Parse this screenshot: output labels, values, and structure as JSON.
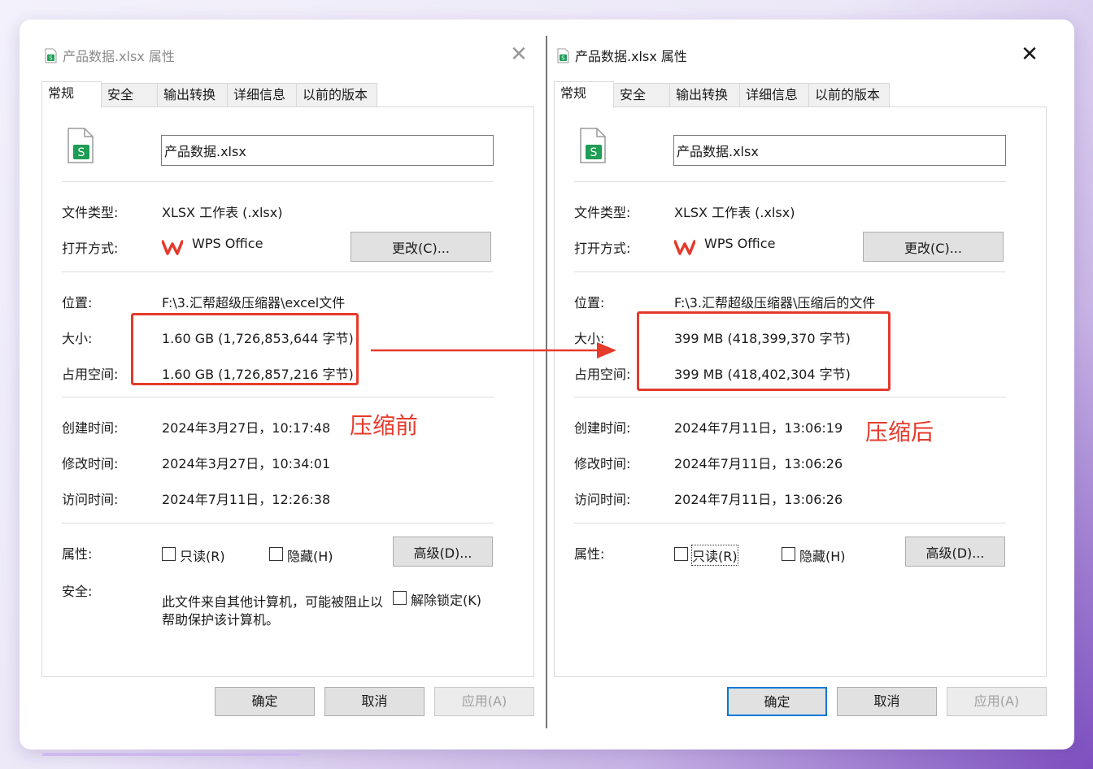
{
  "colors": {
    "accent": "#e53a2c",
    "focus": "#0078d7",
    "excel_green": "#1f9d55"
  },
  "before": {
    "title": "产品数据.xlsx 属性",
    "tabs": [
      "常规",
      "安全",
      "输出转换",
      "详细信息",
      "以前的版本"
    ],
    "file_name": "产品数据.xlsx",
    "labels": {
      "type": "文件类型:",
      "open_with": "打开方式:",
      "location": "位置:",
      "size": "大小:",
      "size_on_disk": "占用空间:",
      "created": "创建时间:",
      "modified": "修改时间:",
      "accessed": "访问时间:",
      "attributes": "属性:",
      "security": "安全:"
    },
    "type_value": "XLSX 工作表 (.xlsx)",
    "open_with_app": "WPS Office",
    "change_button": "更改(C)...",
    "location_value": "F:\\3.汇帮超级压缩器\\excel文件",
    "size_value": "1.60 GB (1,726,853,644 字节)",
    "size_on_disk_value": "1.60 GB (1,726,857,216 字节)",
    "created_value": "2024年3月27日，10:17:48",
    "modified_value": "2024年3月27日，10:34:01",
    "accessed_value": "2024年7月11日，12:26:38",
    "readonly_label": "只读(R)",
    "hidden_label": "隐藏(H)",
    "advanced_button": "高级(D)...",
    "security_text": "此文件来自其他计算机，可能被阻止以帮助保护该计算机。",
    "unblock_label": "解除锁定(K)",
    "ok_button": "确定",
    "cancel_button": "取消",
    "apply_button": "应用(A)",
    "annotation": "压缩前"
  },
  "after": {
    "title": "产品数据.xlsx 属性",
    "tabs": [
      "常规",
      "安全",
      "输出转换",
      "详细信息",
      "以前的版本"
    ],
    "file_name": "产品数据.xlsx",
    "labels": {
      "type": "文件类型:",
      "open_with": "打开方式:",
      "location": "位置:",
      "size": "大小:",
      "size_on_disk": "占用空间:",
      "created": "创建时间:",
      "modified": "修改时间:",
      "accessed": "访问时间:",
      "attributes": "属性:"
    },
    "type_value": "XLSX 工作表 (.xlsx)",
    "open_with_app": "WPS Office",
    "change_button": "更改(C)...",
    "location_value": "F:\\3.汇帮超级压缩器\\压缩后的文件",
    "size_value": "399 MB (418,399,370 字节)",
    "size_on_disk_value": "399 MB (418,402,304 字节)",
    "created_value": "2024年7月11日，13:06:19",
    "modified_value": "2024年7月11日，13:06:26",
    "accessed_value": "2024年7月11日，13:06:26",
    "readonly_label": "只读(R)",
    "hidden_label": "隐藏(H)",
    "advanced_button": "高级(D)...",
    "ok_button": "确定",
    "cancel_button": "取消",
    "apply_button": "应用(A)",
    "annotation": "压缩后"
  }
}
